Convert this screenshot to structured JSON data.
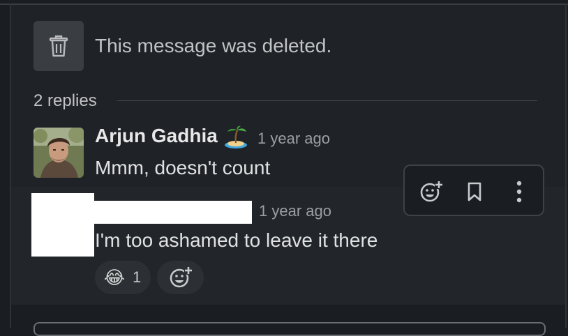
{
  "colors": {
    "background": "#1a1d21",
    "panel": "#1f2226",
    "hover_row": "#222529",
    "muted_text": "#9c9fa3",
    "primary_text": "#e0e1e2",
    "redaction": "#ffffff"
  },
  "deleted_message": {
    "icon": "trash-icon",
    "text": "This message was deleted."
  },
  "thread": {
    "replies_label": "2 replies"
  },
  "replies": [
    {
      "author": "Arjun Gadhia",
      "status_emoji": "desert-island-icon",
      "timestamp": "1 year ago",
      "text": "Mmm, doesn't count"
    },
    {
      "author": "",
      "timestamp": "1 year ago",
      "text": "I'm too ashamed to leave it there",
      "reactions": [
        {
          "emoji": "😂",
          "icon": "joy-emoji-icon",
          "count": "1"
        }
      ]
    }
  ],
  "hover_toolbar": {
    "buttons": [
      "add-reaction-icon",
      "bookmark-icon",
      "more-actions-icon"
    ]
  }
}
